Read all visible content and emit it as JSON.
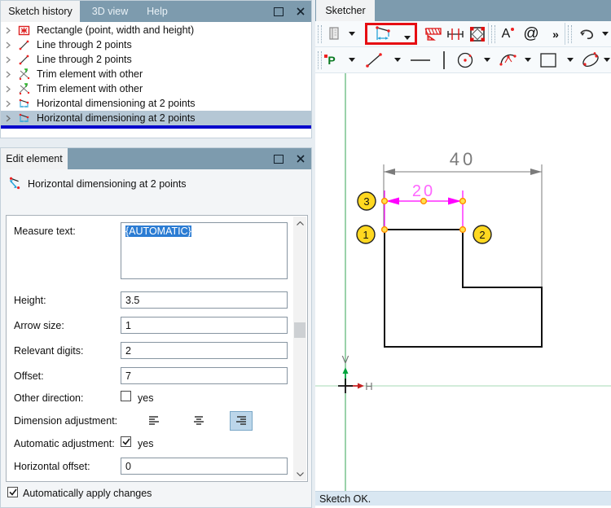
{
  "colors": {
    "titlebar": "#7d9bae",
    "selection_highlight": "#b5c7d5",
    "insert_line_blue": "#0202cc",
    "text_selection_blue": "#2b7cd3",
    "tool_highlight_red": "#e60d12",
    "dimension_magenta": "#ff00ff",
    "balloon_yellow": "#ffd820",
    "axis_green": "#35a455",
    "status_bg": "#d9e7f2"
  },
  "sketch_history": {
    "title": "Sketch history",
    "menu": {
      "view3d": "3D view",
      "help": "Help"
    },
    "items": [
      {
        "icon": "rectangle-icon",
        "label": "Rectangle (point, width and height)"
      },
      {
        "icon": "line-icon",
        "label": "Line through 2 points"
      },
      {
        "icon": "line-icon",
        "label": "Line through 2 points"
      },
      {
        "icon": "trim-icon",
        "label": "Trim element with other"
      },
      {
        "icon": "trim-icon",
        "label": "Trim element with other"
      },
      {
        "icon": "hdim-icon",
        "label": "Horizontal dimensioning at 2 points"
      },
      {
        "icon": "hdim-icon",
        "label": "Horizontal dimensioning at 2 points",
        "selected": true
      }
    ]
  },
  "edit_element": {
    "title": "Edit element",
    "header": "Horizontal dimensioning at 2 points",
    "fields": {
      "measure_text": {
        "label": "Measure text:",
        "value": "{AUTOMATIC}"
      },
      "height": {
        "label": "Height:",
        "value": "3.5"
      },
      "arrow_size": {
        "label": "Arrow size:",
        "value": "1"
      },
      "relevant_digits": {
        "label": "Relevant digits:",
        "value": "2"
      },
      "offset": {
        "label": "Offset:",
        "value": "7"
      },
      "other_direction": {
        "label": "Other direction:",
        "checkbox_label": "yes",
        "checked": false
      },
      "dimension_adjustment": {
        "label": "Dimension adjustment:",
        "selected_option": "right"
      },
      "automatic_adjustment": {
        "label": "Automatic adjustment:",
        "checkbox_label": "yes",
        "checked": true
      },
      "horizontal_offset": {
        "label": "Horizontal offset:",
        "value": "0"
      }
    },
    "apply_label": "Automatically apply changes"
  },
  "sketcher": {
    "title": "Sketcher",
    "toolbar_glyphs": {
      "text_tool": "A",
      "at_tool": "@",
      "more": "»",
      "point_tool": "P"
    },
    "status": "Sketch OK.",
    "canvas": {
      "dim_40": "40",
      "dim_20": "20",
      "balloon_1": "1",
      "balloon_2": "2",
      "balloon_3": "3",
      "v_axis_label": "V",
      "h_axis_label": "H"
    }
  }
}
